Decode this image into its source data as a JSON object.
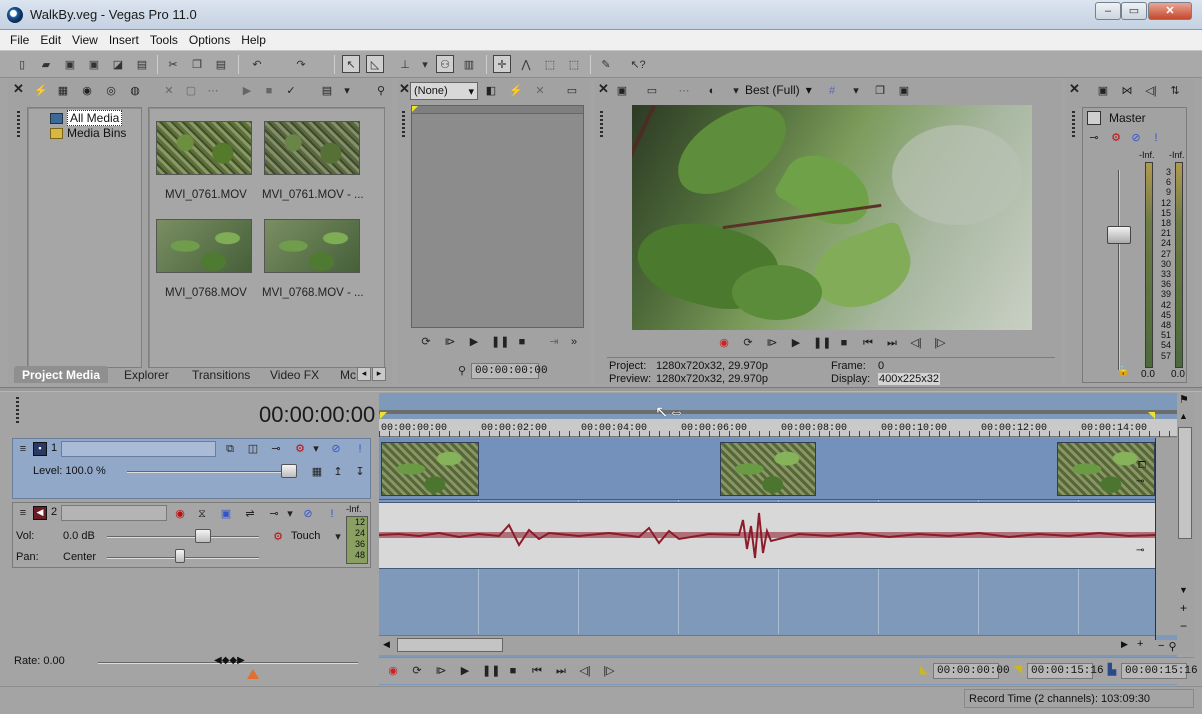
{
  "window": {
    "title": "WalkBy.veg - Vegas Pro 11.0",
    "controls": [
      "–",
      "▭",
      "✕"
    ]
  },
  "menu": [
    "File",
    "Edit",
    "View",
    "Insert",
    "Tools",
    "Options",
    "Help"
  ],
  "media": {
    "tree": [
      "All Media",
      "Media Bins"
    ],
    "items": [
      {
        "name": "MVI_0761.MOV"
      },
      {
        "name": "MVI_0761.MOV - ..."
      },
      {
        "name": "MVI_0768.MOV"
      },
      {
        "name": "MVI_0768.MOV - ..."
      }
    ],
    "tabs": [
      "Project Media",
      "Explorer",
      "Transitions",
      "Video FX",
      "Mc"
    ]
  },
  "trimmer": {
    "preset": "(None)",
    "timecode": "00:00:00:00"
  },
  "preview": {
    "quality": "Best (Full)",
    "project_label": "Project:",
    "project_value": "1280x720x32, 29.970p",
    "preview_label": "Preview:",
    "preview_value": "1280x720x32, 29.970p",
    "frame_label": "Frame:",
    "frame_value": "0",
    "display_label": "Display:",
    "display_value": "400x225x32"
  },
  "master": {
    "title": "Master",
    "left_peak": "-Inf.",
    "right_peak": "-Inf.",
    "scale": [
      "3",
      "6",
      "9",
      "12",
      "15",
      "18",
      "21",
      "24",
      "27",
      "30",
      "33",
      "36",
      "39",
      "42",
      "45",
      "48",
      "51",
      "54",
      "57"
    ],
    "left_value": "0.0",
    "right_value": "0.0"
  },
  "timeline": {
    "cursor_time": "00:00:00:00",
    "ruler": [
      "00:00:00:00",
      "00:00:02:00",
      "00:00:04:00",
      "00:00:06:00",
      "00:00:08:00",
      "00:00:10:00",
      "00:00:12:00",
      "00:00:14:00"
    ],
    "video_track": {
      "number": "1",
      "level": "Level: 100.0 %"
    },
    "audio_track": {
      "number": "2",
      "vol_label": "Vol:",
      "vol_value": "0.0 dB",
      "pan_label": "Pan:",
      "pan_value": "Center",
      "mode": "Touch",
      "meter_top": "-Inf.",
      "meter_scale": [
        "12",
        "24",
        "36",
        "48"
      ]
    },
    "rate": "Rate: 0.00",
    "sel_start": "00:00:00:00",
    "sel_end": "00:00:15:16",
    "sel_length": "00:00:15:16",
    "status": "Record Time (2 channels): 103:09:30"
  }
}
